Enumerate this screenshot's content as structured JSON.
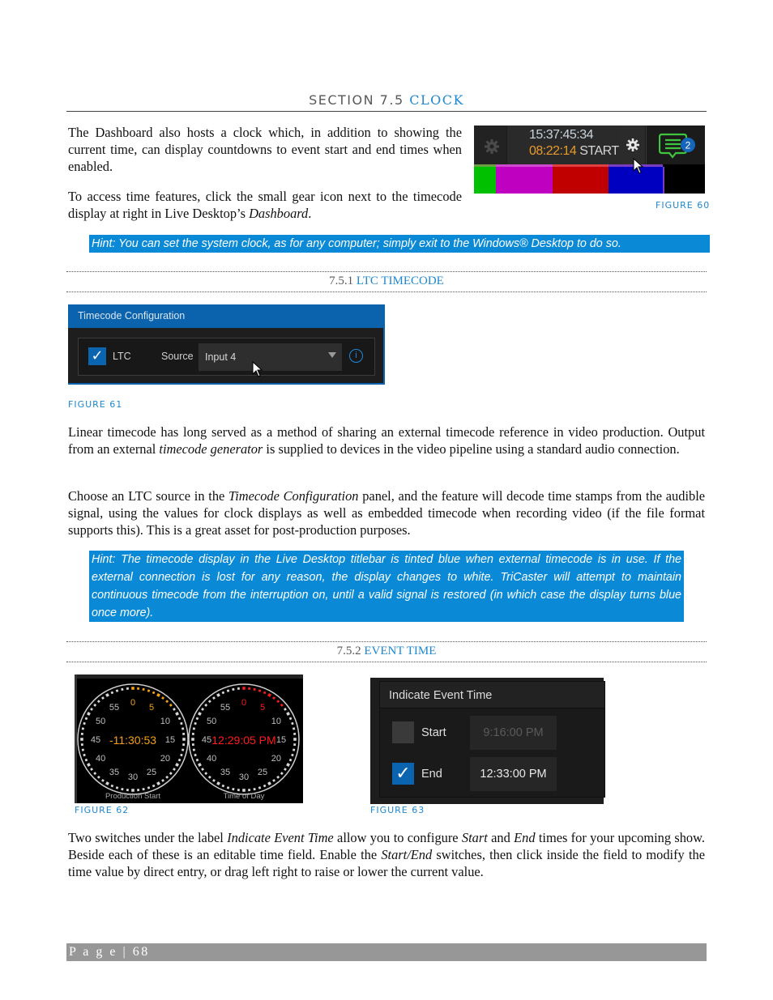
{
  "section": {
    "number": "SECTION 7.5",
    "name": "CLOCK"
  },
  "intro": {
    "p1": "The Dashboard also hosts a clock which, in addition to showing the current time, can display countdowns to event start and end times when enabled.",
    "p2_start": "To access time features, click the small gear icon next to the timecode display at right in Live Desktop’s ",
    "p2_italic": "Dashboard",
    "p2_end": "."
  },
  "figure60": {
    "caption": "FIGURE 60",
    "timecode": "15:37:45:34",
    "countdown": "08:22:14",
    "countdown_label": "START",
    "notification_count": "2",
    "colors": {
      "timecode": "#c9d3dc",
      "countdown": "#e89a2a",
      "notify": "#3ec43e",
      "badge": "#1565b8"
    },
    "color_bars": [
      "#00c000",
      "#c000c0",
      "#c00000",
      "#0000c0"
    ]
  },
  "hint1": "Hint: You can set the system clock, as for any computer; simply exit to the Windows® Desktop to do so.",
  "sub1": {
    "number": "7.5.1",
    "name": "LTC TIMECODE"
  },
  "figure61": {
    "caption": "FIGURE 61",
    "panel_title": "Timecode Configuration",
    "ltc_label": "LTC",
    "ltc_checked": true,
    "source_label": "Source",
    "source_value": "Input 4",
    "info_icon": "i"
  },
  "para_ltc1": {
    "a": "Linear timecode has long served as a method of sharing an external timecode reference in video production. Output from an external ",
    "italic": "timecode generator",
    "b": " is supplied to devices in the video pipeline using a standard audio connection."
  },
  "para_ltc2": {
    "a": "Choose an LTC source in the ",
    "italic": "Timecode Configuration",
    "b": " panel, and the feature will decode time stamps from the audible signal, using the values for clock displays as well as embedded timecode when recording video (if the file format supports this).  This is a great asset for post-production purposes."
  },
  "hint2": "Hint: The timecode display in the Live Desktop titlebar is tinted blue when external timecode is in use. If the external connection is lost for any reason, the display changes to white. TriCaster will attempt to maintain continuous timecode from the interruption on, until a valid signal is restored (in which case the display turns blue once more).",
  "sub2": {
    "number": "7.5.2",
    "name": "EVENT TIME"
  },
  "figure62": {
    "caption": "FIGURE 62",
    "dial_numbers": [
      "0",
      "5",
      "10",
      "15",
      "20",
      "25",
      "30",
      "35",
      "40",
      "45",
      "50",
      "55"
    ],
    "clocks": [
      {
        "time": "-11:30:53",
        "label": "Production Start",
        "color": "#f5a01a"
      },
      {
        "time": "12:29:05 PM",
        "label": "Time of Day",
        "color": "#ff1a1a"
      }
    ]
  },
  "figure63": {
    "caption": "FIGURE 63",
    "title": "Indicate Event Time",
    "rows": [
      {
        "label": "Start",
        "checked": false,
        "value": "9:16:00 PM"
      },
      {
        "label": "End",
        "checked": true,
        "value": "12:33:00 PM"
      }
    ]
  },
  "para_event": {
    "a": "Two switches under the label ",
    "i1": "Indicate Event Time",
    "b": " allow you to configure ",
    "i2": "Start",
    "c": " and ",
    "i3": "End",
    "d": " times for your upcoming show.  Beside each of these is an editable time field.  Enable the ",
    "i4": "Start/End",
    "e": " switches, then click inside the field to modify the time value by direct entry, or drag left right to raise or lower the current value."
  },
  "footer": {
    "page_label": "P a g e  |  68"
  }
}
